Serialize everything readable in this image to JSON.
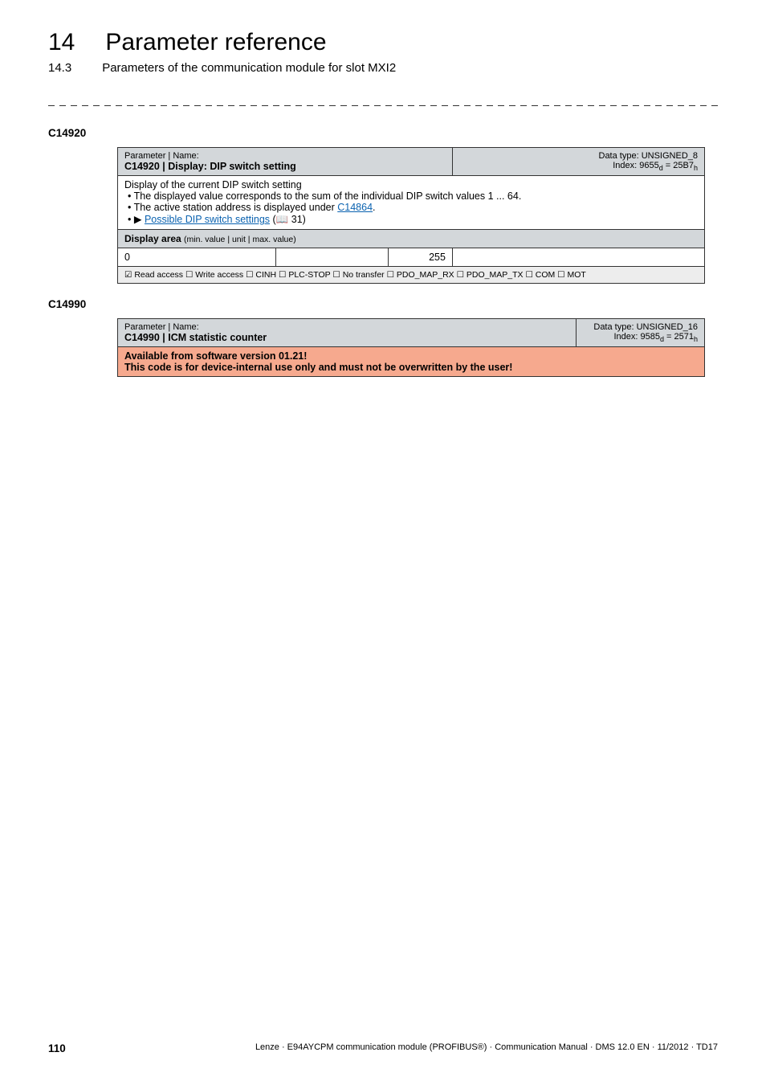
{
  "header": {
    "chapter_num": "14",
    "chapter_title": "Parameter reference",
    "section_num": "14.3",
    "section_title": "Parameters of the communication module for slot MXI2"
  },
  "c14920": {
    "code_label": "C14920",
    "param_label": "Parameter | Name:",
    "code_name": "C14920 | Display: DIP switch setting",
    "dtype_line1": "Data type: UNSIGNED_8",
    "dtype_line2_pre": "Index: 9655",
    "dtype_line2_sub1": "d",
    "dtype_line2_mid": " = 25B7",
    "dtype_line2_sub2": "h",
    "desc_line1": "Display of the current DIP switch setting",
    "desc_b1": "The displayed value corresponds to the sum of the individual DIP switch values 1 ... 64.",
    "desc_b2_pre": "The active station address is displayed under ",
    "desc_b2_link": "C14864",
    "desc_b2_post": ".",
    "desc_b3_arrow": "▶",
    "desc_b3_link": "Possible DIP switch settings",
    "desc_b3_post_pre": " (",
    "desc_b3_book": "📖",
    "desc_b3_post": " 31)",
    "disp_area_lbl": "Display area ",
    "disp_area_sub": "(min. value | unit | max. value)",
    "min": "0",
    "max": "255",
    "flags": "☑ Read access   ☐ Write access   ☐ CINH   ☐ PLC-STOP   ☐ No transfer   ☐ PDO_MAP_RX   ☐ PDO_MAP_TX   ☐ COM   ☐ MOT"
  },
  "c14990": {
    "code_label": "C14990",
    "param_label": "Parameter | Name:",
    "code_name": "C14990 | ICM statistic counter",
    "dtype_line1": "Data type: UNSIGNED_16",
    "dtype_line2_pre": "Index: 9585",
    "dtype_line2_sub1": "d",
    "dtype_line2_mid": " = 2571",
    "dtype_line2_sub2": "h",
    "warn_l1": "Available from software version 01.21!",
    "warn_l2": "This code is for device-internal use only and must not be overwritten by the user!"
  },
  "footer": {
    "page_num": "110",
    "citation": "Lenze · E94AYCPM communication module (PROFIBUS®) · Communication Manual · DMS 12.0 EN · 11/2012 · TD17"
  }
}
